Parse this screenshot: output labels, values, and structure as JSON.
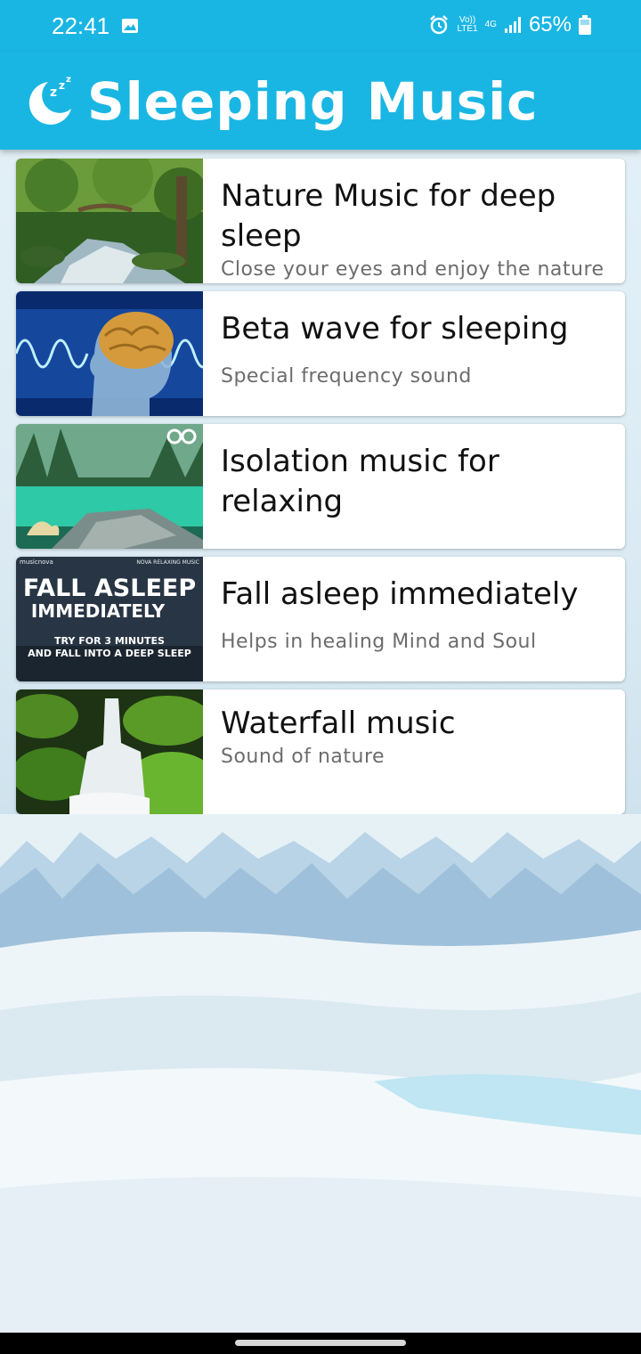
{
  "status_bar": {
    "time": "22:41",
    "network_top": "Vo))",
    "network_bottom": "LTE1",
    "data_type": "4G",
    "battery": "65%"
  },
  "header": {
    "title": "Sleeping Music",
    "accent_color": "#1ab6e3"
  },
  "thumbnails": {
    "fall_asleep_line1": "FALL ASLEEP",
    "fall_asleep_line2": "IMMEDIATELY",
    "fall_asleep_line3": "TRY FOR 3 MINUTES",
    "fall_asleep_line4": "AND FALL INTO A DEEP SLEEP",
    "fall_asleep_brand_left": "musicnova",
    "fall_asleep_brand_right": "NOVA RELAXING MUSIC"
  },
  "tracks": [
    {
      "title": "Nature Music for deep sleep",
      "subtitle": "Close your eyes and enjoy the nature",
      "thumb_icon": "forest-stream"
    },
    {
      "title": "Beta wave for sleeping",
      "subtitle": "Special frequency sound",
      "thumb_icon": "brain-waves"
    },
    {
      "title": "Isolation music for relaxing",
      "subtitle": "",
      "thumb_icon": "green-lake"
    },
    {
      "title": "Fall asleep immediately",
      "subtitle": "Helps in healing Mind and Soul",
      "thumb_icon": "fall-asleep-poster"
    },
    {
      "title": "Waterfall music",
      "subtitle": "Sound of nature",
      "thumb_icon": "waterfall"
    }
  ]
}
